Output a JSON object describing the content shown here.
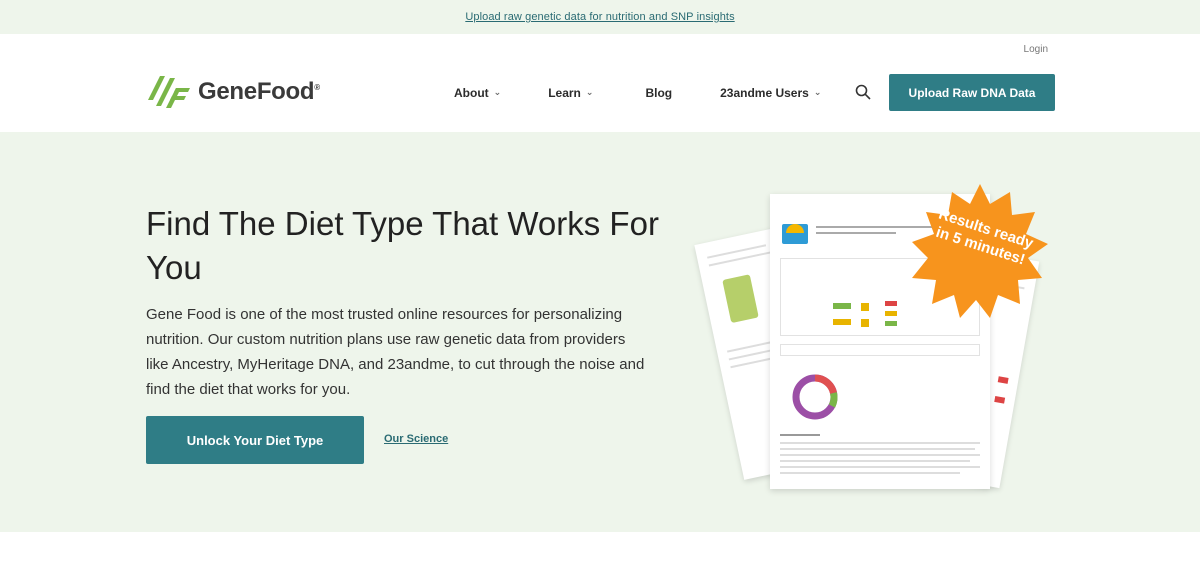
{
  "announcement": {
    "text": "Upload raw genetic data for nutrition and SNP insights"
  },
  "header": {
    "login": "Login",
    "logo_text": "GeneFood",
    "logo_reg": "®",
    "nav": {
      "about": "About",
      "learn": "Learn",
      "blog": "Blog",
      "users23": "23andme Users"
    },
    "upload_button": "Upload Raw DNA Data"
  },
  "hero": {
    "title": "Find The Diet Type That Works For You",
    "description": "Gene Food is one of the most trusted online resources for personalizing nutrition. Our custom nutrition plans use raw genetic data from providers like Ancestry, MyHeritage DNA, and 23andme, to cut through the noise and find the diet that works for you.",
    "cta_button": "Unlock Your Diet Type",
    "science_link": "Our Science",
    "badge_text": "Results ready in 5 minutes!"
  },
  "colors": {
    "accent": "#2f7d86",
    "hero_bg": "#eef5eb",
    "logo_green": "#7ab648",
    "badge_orange": "#f7941d"
  },
  "icons": {
    "search": "search-icon",
    "chevron": "chevron-down-icon",
    "logo": "genefood-logo-icon"
  }
}
